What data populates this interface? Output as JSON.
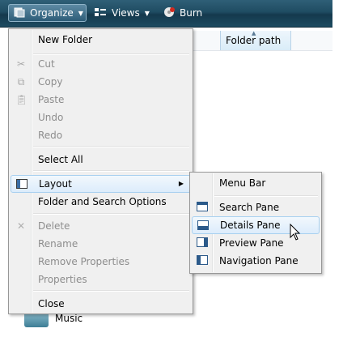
{
  "toolbar": {
    "organize_label": "Organize",
    "views_label": "Views",
    "burn_label": "Burn"
  },
  "columns": {
    "folder_path": "Folder path"
  },
  "background_items": {
    "music": "Music"
  },
  "organize_menu": {
    "items": [
      {
        "label": "New Folder",
        "enabled": true
      },
      {
        "label": "Cut",
        "enabled": false,
        "icon": "scissors-icon"
      },
      {
        "label": "Copy",
        "enabled": false,
        "icon": "copy-icon"
      },
      {
        "label": "Paste",
        "enabled": false,
        "icon": "clipboard-icon"
      },
      {
        "label": "Undo",
        "enabled": false
      },
      {
        "label": "Redo",
        "enabled": false
      },
      {
        "label": "Select All",
        "enabled": true
      },
      {
        "label": "Layout",
        "enabled": true,
        "icon": "layout-icon",
        "submenu": true,
        "highlighted": true
      },
      {
        "label": "Folder and Search Options",
        "enabled": true
      },
      {
        "label": "Delete",
        "enabled": false,
        "icon": "delete-x-icon"
      },
      {
        "label": "Rename",
        "enabled": false
      },
      {
        "label": "Remove Properties",
        "enabled": false
      },
      {
        "label": "Properties",
        "enabled": false
      },
      {
        "label": "Close",
        "enabled": true
      }
    ]
  },
  "layout_submenu": {
    "items": [
      {
        "label": "Menu Bar",
        "icon": "none"
      },
      {
        "label": "Search Pane",
        "icon": "search-pane-icon"
      },
      {
        "label": "Details Pane",
        "icon": "details-pane-icon",
        "highlighted": true
      },
      {
        "label": "Preview Pane",
        "icon": "preview-pane-icon"
      },
      {
        "label": "Navigation Pane",
        "icon": "navigation-pane-icon"
      }
    ]
  },
  "colors": {
    "toolbar": "#1f4c62",
    "menu_bg": "#f0f0f0",
    "highlight_border": "#a8d0f0",
    "disabled_text": "#8d8d8d"
  }
}
